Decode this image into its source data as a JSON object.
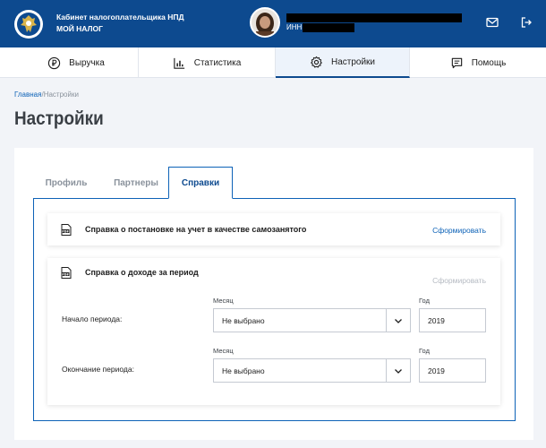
{
  "header": {
    "title_line1": "Кабинет налогоплательщика НПД",
    "title_line2": "МОЙ НАЛОГ",
    "inn_label": "ИНН"
  },
  "nav": {
    "items": [
      {
        "label": "Выручка",
        "icon": "ruble-icon"
      },
      {
        "label": "Статистика",
        "icon": "bar-chart-icon"
      },
      {
        "label": "Настройки",
        "icon": "gear-icon",
        "active": true
      },
      {
        "label": "Помощь",
        "icon": "message-icon"
      }
    ]
  },
  "breadcrumb": {
    "home": "Главная",
    "separator": "/",
    "current": "Настройки"
  },
  "page_title": "Настройки",
  "tabs": [
    {
      "label": "Профиль"
    },
    {
      "label": "Партнеры"
    },
    {
      "label": "Справки",
      "active": true
    }
  ],
  "certificates": {
    "registration": {
      "title": "Справка о постановке на учет в качестве самозанятого",
      "action": "Сформировать"
    },
    "income": {
      "title": "Справка о доходе за период",
      "action": "Сформировать",
      "start": {
        "label": "Начало периода:",
        "month_caption": "Месяц",
        "month_value": "Не выбрано",
        "year_caption": "Год",
        "year_value": "2019"
      },
      "end": {
        "label": "Окончание периода:",
        "month_caption": "Месяц",
        "month_value": "Не выбрано",
        "year_caption": "Год",
        "year_value": "2019"
      }
    }
  },
  "colors": {
    "brand": "#0d4a8f",
    "link": "#0d62b7",
    "disabled": "#b5bac2"
  }
}
